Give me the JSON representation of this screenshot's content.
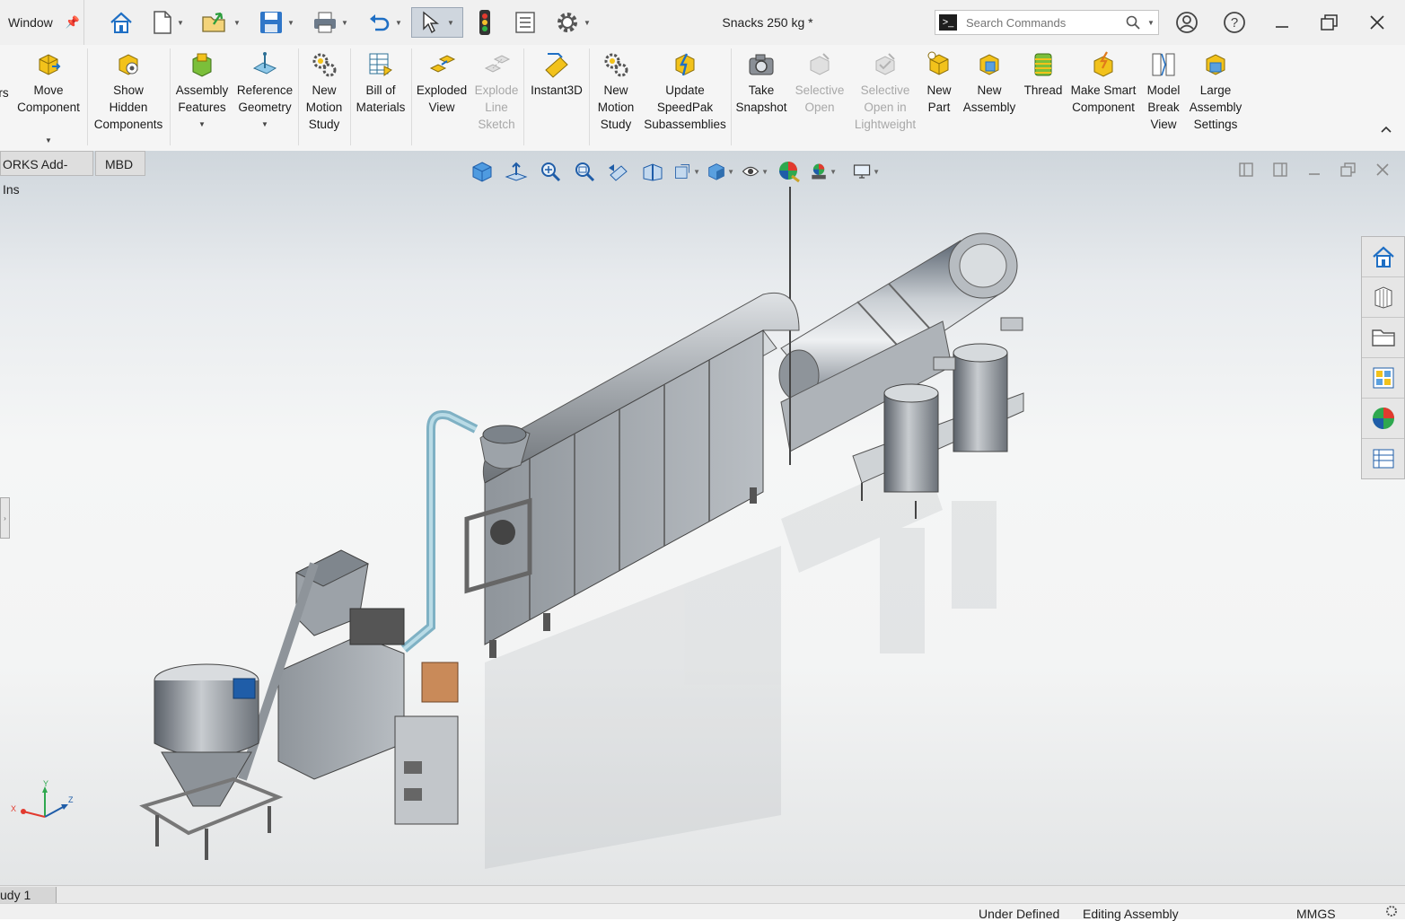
{
  "titlebar": {
    "menu": "Window",
    "document_title": "Snacks 250 kg *",
    "search_placeholder": "Search Commands"
  },
  "ribbon": {
    "buttons": [
      {
        "label": "rs",
        "disabled": false
      },
      {
        "label": "Move Component",
        "disabled": false
      },
      {
        "label": "Show Hidden Components",
        "disabled": false
      },
      {
        "label": "Assembly Features",
        "disabled": false
      },
      {
        "label": "Reference Geometry",
        "disabled": false
      },
      {
        "label": "New Motion Study",
        "disabled": false
      },
      {
        "label": "Bill of Materials",
        "disabled": false
      },
      {
        "label": "Exploded View",
        "disabled": false
      },
      {
        "label": "Explode Line Sketch",
        "disabled": true
      },
      {
        "label": "Instant3D",
        "disabled": false
      },
      {
        "label": "New Motion Study",
        "disabled": false
      },
      {
        "label": "Update SpeedPak Subassemblies",
        "disabled": false
      },
      {
        "label": "Take Snapshot",
        "disabled": false
      },
      {
        "label": "Selective Open",
        "disabled": true
      },
      {
        "label": "Selective Open in Lightweight",
        "disabled": true
      },
      {
        "label": "New Part",
        "disabled": false
      },
      {
        "label": "New Assembly",
        "disabled": false
      },
      {
        "label": "Thread",
        "disabled": false
      },
      {
        "label": "Make Smart Component",
        "disabled": false
      },
      {
        "label": "Model Break View",
        "disabled": false
      },
      {
        "label": "Large Assembly Settings",
        "disabled": false
      }
    ]
  },
  "tabs": [
    {
      "label": "ORKS Add-Ins"
    },
    {
      "label": "MBD"
    }
  ],
  "triad": {
    "x": "X",
    "y": "Y",
    "z": "Z"
  },
  "bottom": {
    "motion_tab": "udy 1",
    "status_defined": "Under Defined",
    "status_mode": "Editing Assembly",
    "status_units": "MMGS"
  },
  "colors": {
    "ribbon_bg": "#f5f5f5",
    "accent_blue": "#1f6fc4",
    "icon_yellow": "#f2c21b"
  }
}
